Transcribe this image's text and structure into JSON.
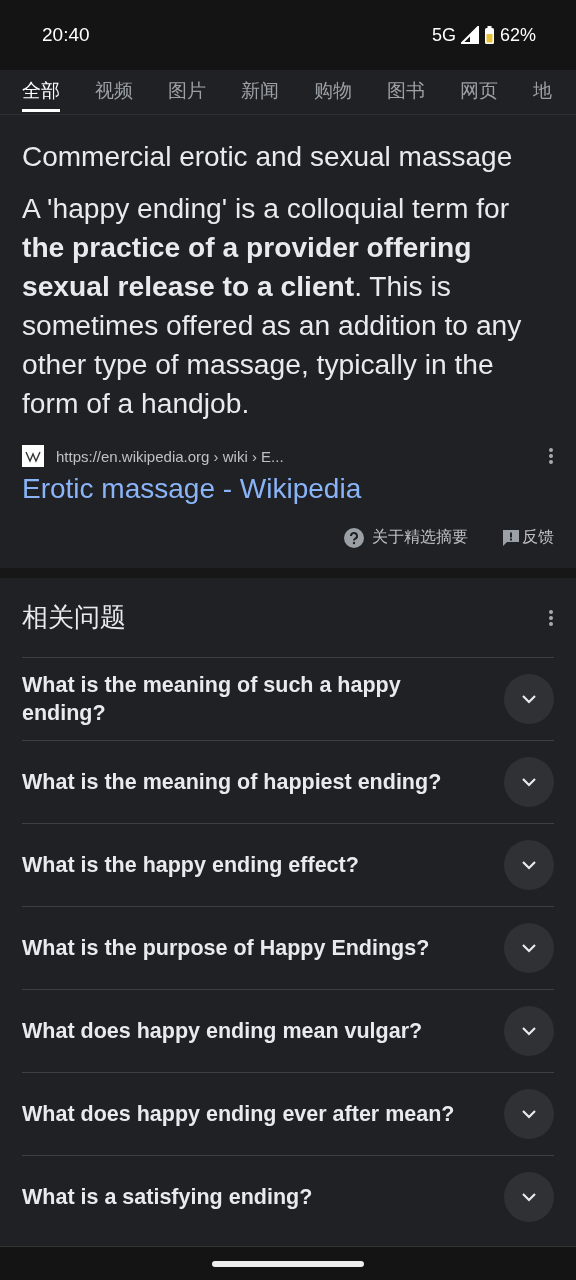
{
  "status_bar": {
    "time": "20:40",
    "network": "5G",
    "battery": "62%"
  },
  "tabs": [
    {
      "label": "全部",
      "selected": true
    },
    {
      "label": "视频",
      "selected": false
    },
    {
      "label": "图片",
      "selected": false
    },
    {
      "label": "新闻",
      "selected": false
    },
    {
      "label": "购物",
      "selected": false
    },
    {
      "label": "图书",
      "selected": false
    },
    {
      "label": "网页",
      "selected": false
    },
    {
      "label": "地",
      "selected": false
    }
  ],
  "snippet": {
    "heading": "Commercial erotic and sexual massage",
    "text": "A 'happy ending' is a colloquial term for **the practice of a provider offering sexual release to a client**. This is sometimes offered as an addition to any other type of massage, typically in the form of a handjob.",
    "source_url": "https://en.wikipedia.org › wiki › E...",
    "source_title": "Erotic massage - Wikipedia",
    "about_label": "关于精选摘要",
    "feedback_label": "反馈"
  },
  "related_questions": {
    "title": "相关问题",
    "items": [
      {
        "text": "What is the meaning of such a happy ending?",
        "expanded": false
      },
      {
        "text": "What is the meaning of happiest ending?",
        "expanded": false
      },
      {
        "text": "What is the happy ending effect?",
        "expanded": false
      },
      {
        "text": "What is the purpose of Happy Endings?",
        "expanded": false
      },
      {
        "text": "What does happy ending mean vulgar?",
        "expanded": false
      },
      {
        "text": "What does happy ending ever after mean?",
        "expanded": false
      },
      {
        "text": "What is a satisfying ending?",
        "expanded": false
      }
    ]
  }
}
